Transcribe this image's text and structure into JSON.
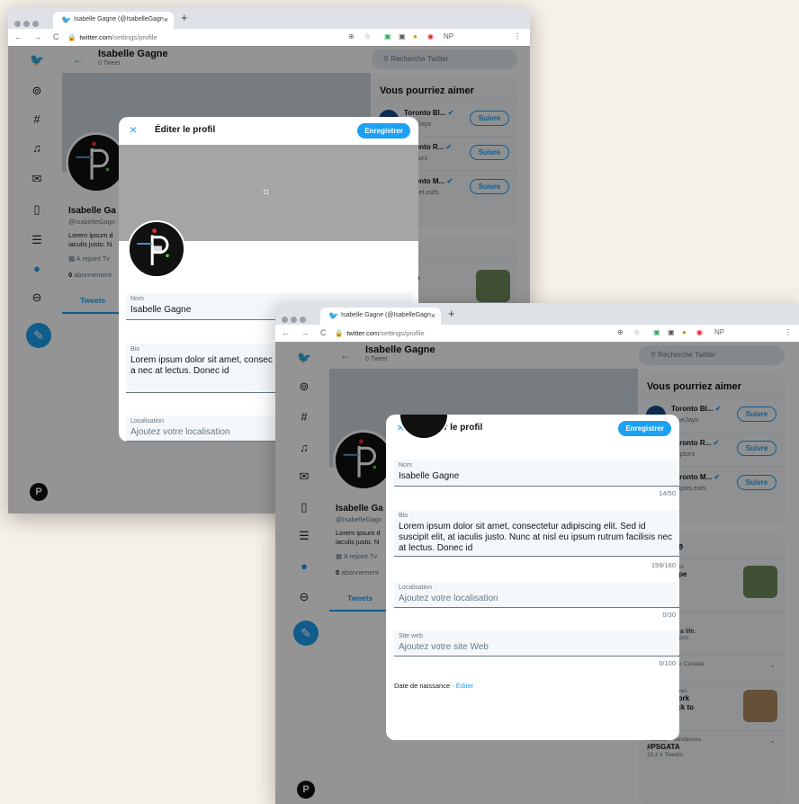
{
  "browser": {
    "tab_title": "Isabelle Gagne (@IsabelleGagn",
    "tab_close": "×",
    "new_tab": "+",
    "nav_buttons": "← → C",
    "lock": "🔒",
    "url_host": "twitter.com",
    "url_path": "/settings/profile",
    "ext_np": "NP",
    "ext_menu": "⋮"
  },
  "profile": {
    "name": "Isabelle Gagne",
    "tweets": "0 Tweet",
    "display_name": "Isabelle Ga",
    "handle": "@IsabelleGagn",
    "bio_short_1": "Lorem ipsum d",
    "bio_short_2": "iaculis justo. N",
    "joined": "A rejoint Tv",
    "following_count": "0",
    "following_label": " abonnement",
    "tab_tweets": "Tweets"
  },
  "right": {
    "search_placeholder": "Recherche Twitter",
    "suggest_title": "Vous pourriez aimer",
    "follow_label": "Suivre",
    "accounts": [
      {
        "name": "Toronto Bl...",
        "handle": "BlueJays"
      },
      {
        "name": "Toronto R...",
        "handle": "Raptors"
      },
      {
        "name": "Toronto M...",
        "handle": "MapleLeafs"
      }
    ],
    "trends_title": "e passe",
    "trend1_meta": "Il y a 4 heures",
    "trend1_title": "s best hope\nCovid-19\nmes from",
    "trend2_title": "pDay",
    "trend2_text": "e. Change a life.",
    "trend2_meta": "par Tim Hortons",
    "trend3_meta": "s la catégorie Canada",
    "trend4_meta": "- Il y a 4 heures",
    "trend4_title": "g pods work\ngoing back to\nschool?",
    "trend5_meta": "Football · Tendances",
    "trend5_title": "#PSGATA",
    "trend5_count": "10,2 k Tweets"
  },
  "modal": {
    "close": "×",
    "title": "Éditer le profil",
    "save": "Enregistrer",
    "name_label": "Nom",
    "name_value": "Isabelle Gagne",
    "name_count": "14/50",
    "bio_label": "Bio",
    "bio_value": "Lorem ipsum dolor sit amet, consectetur adipiscing elit. Sed id suscipit elit, at iaculis justo. Nunc at nisl eu ipsum rutrum facilisis nec at lectus. Donec id",
    "bio_value_cut": "Lorem ipsum dolor sit amet, consec suscipit elit, at iaculis justo. Nunc a nec at lectus. Donec id",
    "bio_count": "159/160",
    "location_label": "Localisation",
    "location_placeholder": "Ajoutez votre localisation",
    "location_count": "0/30",
    "web_label": "Site web",
    "web_placeholder": "Ajoutez votre site Web",
    "web_count": "0/100",
    "dob_label": "Date de naissance · ",
    "dob_edit": "Éditer"
  },
  "colors": {
    "accent": "#1da1f2",
    "text": "#0f1419",
    "muted": "#657786",
    "backdrop": "#f5f0e8"
  }
}
